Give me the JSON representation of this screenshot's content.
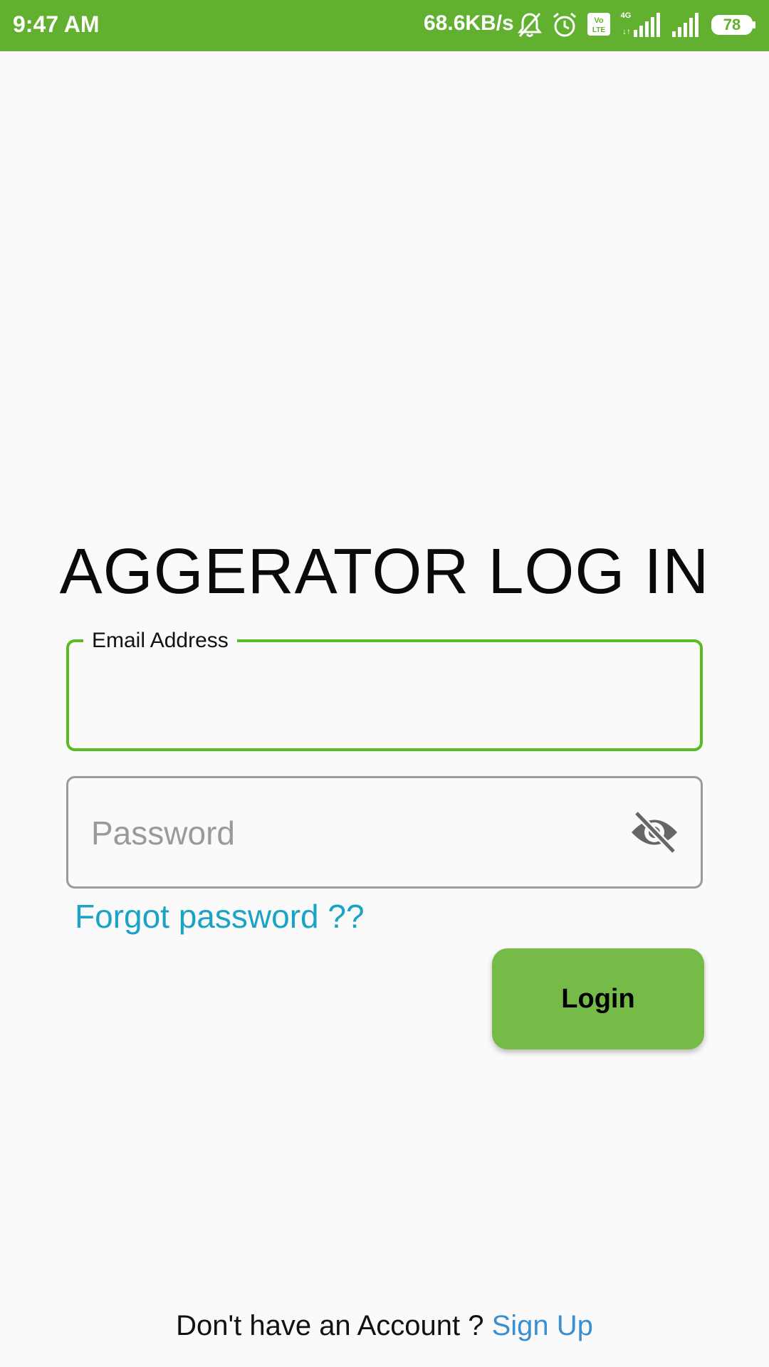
{
  "status_bar": {
    "time": "9:47 AM",
    "net_speed": "68.6KB/s",
    "battery": "78",
    "icons": [
      "bell-off-icon",
      "alarm-icon",
      "volte-icon",
      "signal-4g-icon",
      "signal-icon",
      "battery-icon"
    ],
    "color": "#62b02f"
  },
  "title": "AGGERATOR LOG IN",
  "email": {
    "label": "Email Address",
    "value": "",
    "accent_color": "#57bb23"
  },
  "password": {
    "placeholder": "Password",
    "value": "",
    "toggle_icon": "eye-off-icon"
  },
  "forgot_password": "Forgot password ??",
  "login_button": "Login",
  "footer": {
    "no_account_text": "Don't have an Account ? ",
    "signup_link": "Sign Up"
  }
}
